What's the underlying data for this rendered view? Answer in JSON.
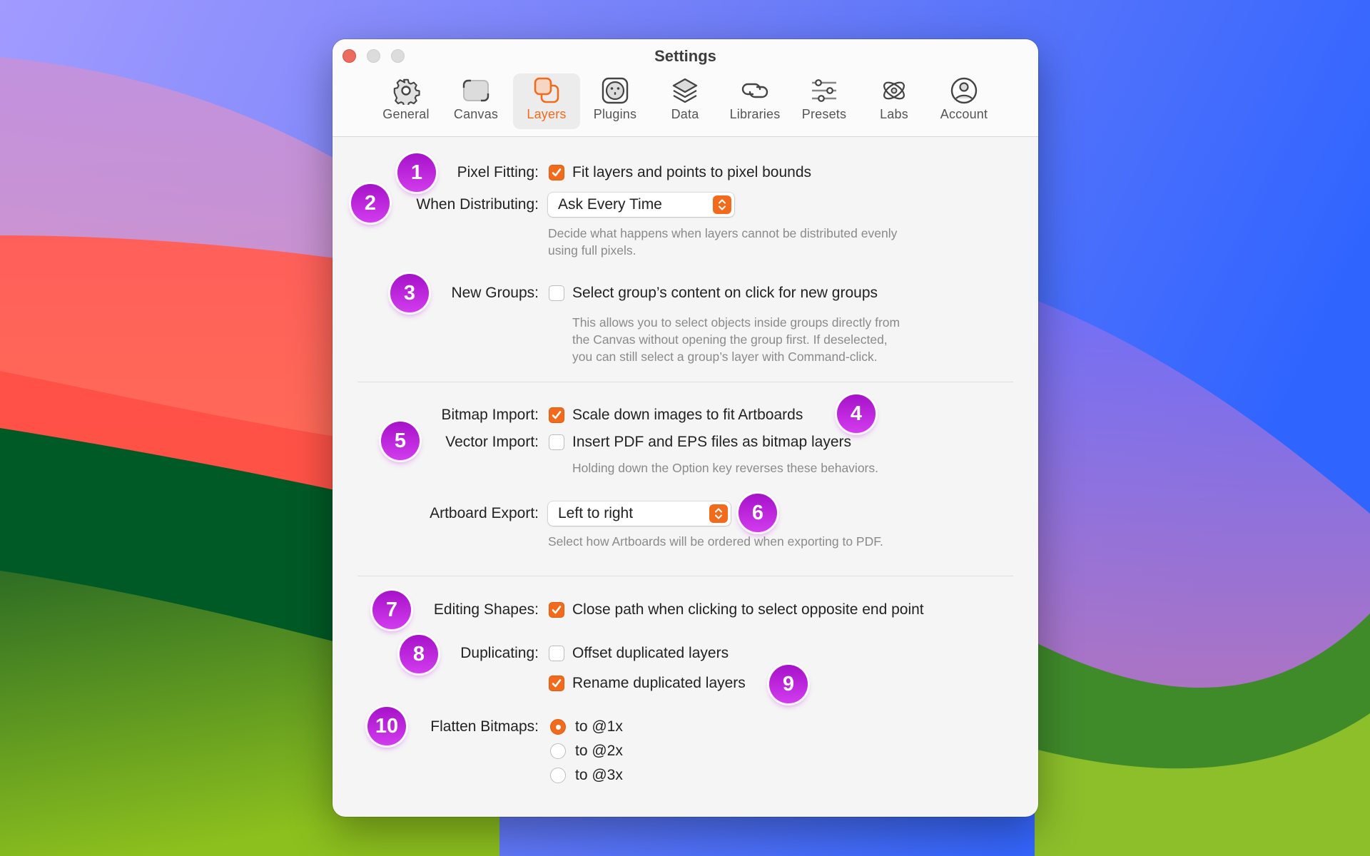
{
  "window": {
    "title": "Settings"
  },
  "tabs": [
    {
      "label": "General",
      "icon": "gear-icon",
      "selected": false
    },
    {
      "label": "Canvas",
      "icon": "canvas-icon",
      "selected": false
    },
    {
      "label": "Layers",
      "icon": "layers-stack-icon",
      "selected": true
    },
    {
      "label": "Plugins",
      "icon": "plug-socket-icon",
      "selected": false
    },
    {
      "label": "Data",
      "icon": "layers-data-icon",
      "selected": false
    },
    {
      "label": "Libraries",
      "icon": "link-icon",
      "selected": false
    },
    {
      "label": "Presets",
      "icon": "sliders-icon",
      "selected": false
    },
    {
      "label": "Labs",
      "icon": "atom-icon",
      "selected": false
    },
    {
      "label": "Account",
      "icon": "person-circle-icon",
      "selected": false
    }
  ],
  "settings": {
    "pixel_fitting": {
      "label": "Pixel Fitting:",
      "option": "Fit layers and points to pixel bounds",
      "checked": true
    },
    "when_distributing": {
      "label": "When Distributing:",
      "value": "Ask Every Time",
      "hint_line1": "Decide what happens when layers cannot be distributed evenly",
      "hint_line2": "using full pixels."
    },
    "new_groups": {
      "label": "New Groups:",
      "option": "Select group’s content on click for new groups",
      "checked": false,
      "hint_line1": "This allows you to select objects inside groups directly from",
      "hint_line2": "the Canvas without opening the group first. If deselected,",
      "hint_line3": "you can still select a group’s layer with Command-click."
    },
    "bitmap_import": {
      "label": "Bitmap Import:",
      "option": "Scale down images to fit Artboards",
      "checked": true
    },
    "vector_import": {
      "label": "Vector Import:",
      "option": "Insert PDF and EPS files as bitmap layers",
      "checked": false,
      "hint": "Holding down the Option key reverses these behaviors."
    },
    "artboard_export": {
      "label": "Artboard Export:",
      "value": "Left to right",
      "hint": "Select how Artboards will be ordered when exporting to PDF."
    },
    "editing_shapes": {
      "label": "Editing Shapes:",
      "option": "Close path when clicking to select opposite end point",
      "checked": true
    },
    "duplicating": {
      "label": "Duplicating:",
      "option_offset": "Offset duplicated layers",
      "offset_checked": false,
      "option_rename": "Rename duplicated layers",
      "rename_checked": true
    },
    "flatten_bitmaps": {
      "label": "Flatten Bitmaps:",
      "options": [
        "to @1x",
        "to @2x",
        "to @3x"
      ],
      "selected": "to @1x"
    }
  },
  "badges": [
    "1",
    "2",
    "3",
    "4",
    "5",
    "6",
    "7",
    "8",
    "9",
    "10"
  ],
  "colors": {
    "accent": "#f26b1d",
    "badge": "#c02ee0"
  }
}
